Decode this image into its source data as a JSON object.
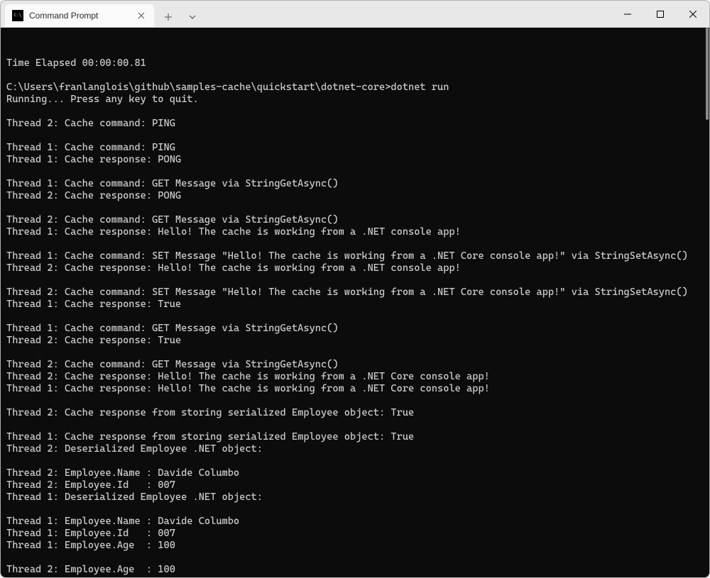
{
  "window": {
    "tab_title": "Command Prompt",
    "tab_icon_label": "C:\\"
  },
  "terminal_lines": [
    "Time Elapsed 00:00:00.81",
    "",
    "C:\\Users\\franlanglois\\github\\samples-cache\\quickstart\\dotnet-core>dotnet run",
    "Running... Press any key to quit.",
    "",
    "Thread 2: Cache command: PING",
    "",
    "Thread 1: Cache command: PING",
    "Thread 1: Cache response: PONG",
    "",
    "Thread 1: Cache command: GET Message via StringGetAsync()",
    "Thread 2: Cache response: PONG",
    "",
    "Thread 2: Cache command: GET Message via StringGetAsync()",
    "Thread 1: Cache response: Hello! The cache is working from a .NET console app!",
    "",
    "Thread 1: Cache command: SET Message \"Hello! The cache is working from a .NET Core console app!\" via StringSetAsync()",
    "Thread 2: Cache response: Hello! The cache is working from a .NET console app!",
    "",
    "Thread 2: Cache command: SET Message \"Hello! The cache is working from a .NET Core console app!\" via StringSetAsync()",
    "Thread 1: Cache response: True",
    "",
    "Thread 1: Cache command: GET Message via StringGetAsync()",
    "Thread 2: Cache response: True",
    "",
    "Thread 2: Cache command: GET Message via StringGetAsync()",
    "Thread 2: Cache response: Hello! The cache is working from a .NET Core console app!",
    "Thread 1: Cache response: Hello! The cache is working from a .NET Core console app!",
    "",
    "Thread 2: Cache response from storing serialized Employee object: True",
    "",
    "Thread 1: Cache response from storing serialized Employee object: True",
    "Thread 2: Deserialized Employee .NET object:",
    "",
    "Thread 2: Employee.Name : Davide Columbo",
    "Thread 2: Employee.Id   : 007",
    "Thread 1: Deserialized Employee .NET object:",
    "",
    "Thread 1: Employee.Name : Davide Columbo",
    "Thread 1: Employee.Id   : 007",
    "Thread 1: Employee.Age  : 100",
    "",
    "Thread 2: Employee.Age  : 100"
  ]
}
